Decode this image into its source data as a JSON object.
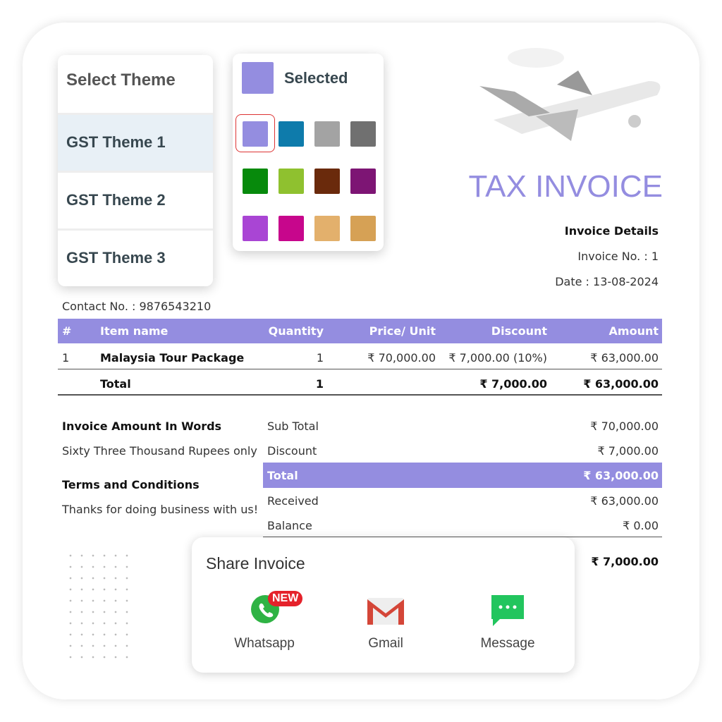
{
  "theme_menu": {
    "title": "Select Theme",
    "items": [
      {
        "label": "GST Theme 1",
        "selected": true
      },
      {
        "label": "GST Theme 2"
      },
      {
        "label": "GST Theme 3"
      }
    ]
  },
  "color_panel": {
    "selected_label": "Selected",
    "selected_color": "#948de0",
    "colors": [
      "#948de0",
      "#0e7bab",
      "#a3a3a3",
      "#707070",
      "#078a0c",
      "#8fc12f",
      "#6a2a0c",
      "#7d1574",
      "#a945d4",
      "#c7068c",
      "#e3b06c",
      "#d6a155"
    ]
  },
  "invoice": {
    "title": "TAX INVOICE",
    "details_heading": "Invoice Details",
    "invoice_no": "Invoice No. : 1",
    "date": "Date : 13-08-2024",
    "contact": "Contact No. : 9876543210",
    "table": {
      "headers": [
        "#",
        "Item name",
        "Quantity",
        "Price/ Unit",
        "Discount",
        "Amount"
      ],
      "rows": [
        [
          "1",
          "Malaysia Tour Package",
          "1",
          "₹ 70,000.00",
          "₹ 7,000.00 (10%)",
          "₹ 63,000.00"
        ]
      ],
      "total": {
        "label": "Total",
        "quantity": "1",
        "discount": "₹ 7,000.00",
        "amount": "₹ 63,000.00"
      }
    },
    "words_heading": "Invoice Amount In Words",
    "words": "Sixty Three Thousand Rupees only",
    "terms_heading": "Terms and Conditions",
    "terms": "Thanks for doing business with us!",
    "summary": [
      {
        "label": "Sub Total",
        "value": "₹ 70,000.00"
      },
      {
        "label": "Discount",
        "value": "₹ 7,000.00"
      },
      {
        "label": "Total",
        "value": "₹ 63,000.00",
        "highlight": true
      },
      {
        "label": "Received",
        "value": "₹ 63,000.00"
      },
      {
        "label": "Balance",
        "value": "₹ 0.00"
      }
    ],
    "savings": "₹ 7,000.00"
  },
  "share": {
    "title": "Share Invoice",
    "options": [
      {
        "label": "Whatsapp",
        "badge": "NEW",
        "icon": "whatsapp-icon"
      },
      {
        "label": "Gmail",
        "icon": "gmail-icon"
      },
      {
        "label": "Message",
        "icon": "message-icon"
      }
    ]
  }
}
